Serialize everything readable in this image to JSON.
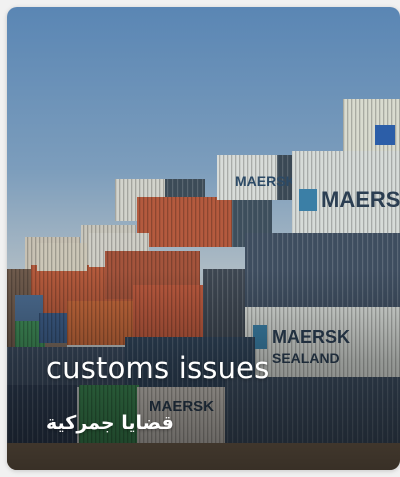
{
  "card": {
    "title": "customs issues",
    "subtitle": "قضايا جمركية",
    "photo": "stacked-shipping-containers-photo",
    "container_brand": "MAERSK",
    "container_sub_label": "SEALAND",
    "colors": {
      "sky_top": "#5a86b4",
      "sky_bottom": "#c7cbca",
      "maersk_blue": "#2c4a66",
      "container_red": "#b7573c",
      "container_white": "#d8dcd9",
      "container_green": "#3f8b58"
    }
  }
}
